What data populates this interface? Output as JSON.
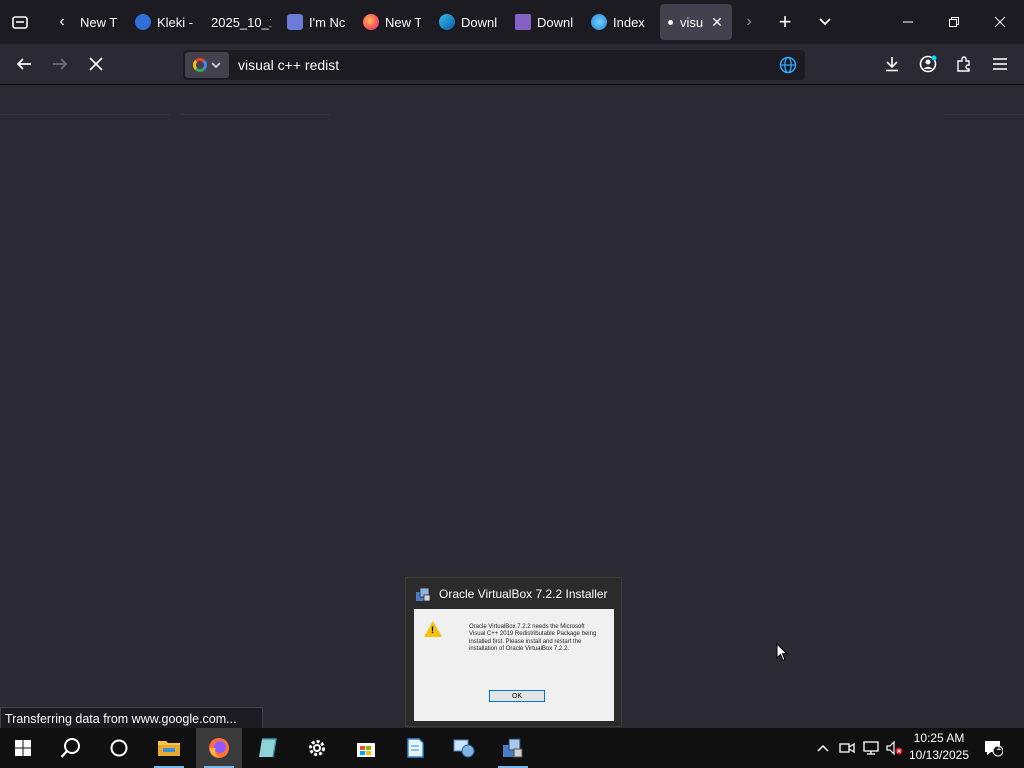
{
  "browser": {
    "tabs": [
      {
        "label": "New T",
        "icon": "new-tab-icon"
      },
      {
        "label": "Kleki -",
        "icon": "kleki-icon"
      },
      {
        "label": "2025_10_1",
        "icon": "blank-icon"
      },
      {
        "label": "I'm Nc",
        "icon": "robot-icon"
      },
      {
        "label": "New T",
        "icon": "firefox-icon"
      },
      {
        "label": "Downl",
        "icon": "edge-icon"
      },
      {
        "label": "Downl",
        "icon": "visual-studio-icon"
      },
      {
        "label": "Index",
        "icon": "globe-icon"
      },
      {
        "label": "visu",
        "icon": "loading-dot-icon",
        "active": true
      }
    ],
    "url": "visual c++ redist",
    "status": "Transferring data from www.google.com..."
  },
  "dialog": {
    "title": "Oracle VirtualBox 7.2.2 Installer",
    "message": "Oracle VirtualBox 7.2.2 needs the Microsoft Visual C++ 2019 Redistributable Package being installed first. Please install and restart the installation of Oracle VirtualBox 7.2.2.",
    "ok_label": "OK"
  },
  "taskbar": {
    "time": "10:25 AM",
    "date": "10/13/2025",
    "notifications": "1"
  },
  "colors": {
    "tabbar": "#1c1b22",
    "content": "#2b2a33",
    "active_tab": "#42414d",
    "taskbar": "#101010",
    "accent": "#0078d7"
  }
}
